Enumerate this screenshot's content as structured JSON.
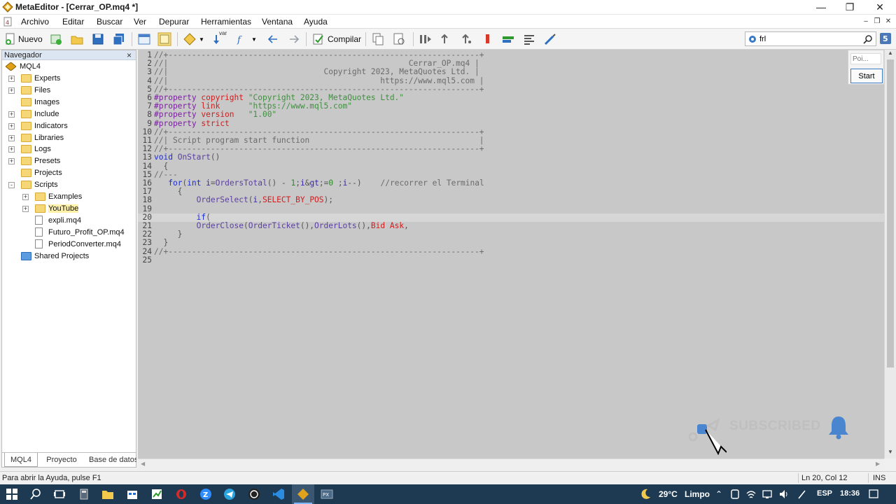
{
  "window": {
    "title": "MetaEditor - [Cerrar_OP.mq4 *]"
  },
  "menu": [
    "Archivo",
    "Editar",
    "Buscar",
    "Ver",
    "Depurar",
    "Herramientas",
    "Ventana",
    "Ayuda"
  ],
  "toolbar": {
    "new_label": "Nuevo",
    "compile_label": "Compilar",
    "var_label": "var",
    "search_value": "frl"
  },
  "navigator": {
    "title": "Navegador",
    "root": "MQL4",
    "items": [
      {
        "label": "Experts",
        "type": "folder",
        "level": 1,
        "expander": "+"
      },
      {
        "label": "Files",
        "type": "folder",
        "level": 1,
        "expander": "+"
      },
      {
        "label": "Images",
        "type": "folder",
        "level": 1,
        "expander": ""
      },
      {
        "label": "Include",
        "type": "folder",
        "level": 1,
        "expander": "+"
      },
      {
        "label": "Indicators",
        "type": "folder",
        "level": 1,
        "expander": "+"
      },
      {
        "label": "Libraries",
        "type": "folder",
        "level": 1,
        "expander": "+"
      },
      {
        "label": "Logs",
        "type": "folder",
        "level": 1,
        "expander": "+"
      },
      {
        "label": "Presets",
        "type": "folder",
        "level": 1,
        "expander": "+"
      },
      {
        "label": "Projects",
        "type": "folder",
        "level": 1,
        "expander": ""
      },
      {
        "label": "Scripts",
        "type": "folder",
        "level": 1,
        "expander": "-"
      },
      {
        "label": "Examples",
        "type": "folder",
        "level": 2,
        "expander": "+"
      },
      {
        "label": "YouTube",
        "type": "folder",
        "level": 2,
        "expander": "+",
        "selected": true
      },
      {
        "label": "expli.mq4",
        "type": "file",
        "level": 2,
        "expander": ""
      },
      {
        "label": "Futuro_Profit_OP.mq4",
        "type": "file",
        "level": 2,
        "expander": ""
      },
      {
        "label": "PeriodConverter.mq4",
        "type": "file",
        "level": 2,
        "expander": ""
      },
      {
        "label": "Shared Projects",
        "type": "shared",
        "level": 1,
        "expander": ""
      }
    ],
    "tabs": [
      "MQL4",
      "Proyecto",
      "Base de datos"
    ]
  },
  "code_lines": [
    {
      "n": "1",
      "t": "//+------------------------------------------------------------------+"
    },
    {
      "n": "2",
      "t": "//|                                                   Cerrar_OP.mq4 |"
    },
    {
      "n": "3",
      "t": "//|                                 Copyright 2023, MetaQuotes Ltd. |"
    },
    {
      "n": "4",
      "t": "//|                                             https://www.mql5.com |"
    },
    {
      "n": "5",
      "t": "//+------------------------------------------------------------------+"
    },
    {
      "n": "6",
      "t": "#property copyright \"Copyright 2023, MetaQuotes Ltd.\""
    },
    {
      "n": "7",
      "t": "#property link      \"https://www.mql5.com\""
    },
    {
      "n": "8",
      "t": "#property version   \"1.00\""
    },
    {
      "n": "9",
      "t": "#property strict"
    },
    {
      "n": "10",
      "t": "//+------------------------------------------------------------------+"
    },
    {
      "n": "11",
      "t": "//| Script program start function                                    |"
    },
    {
      "n": "12",
      "t": "//+------------------------------------------------------------------+"
    },
    {
      "n": "13",
      "t": "void OnStart()"
    },
    {
      "n": "14",
      "t": "  {"
    },
    {
      "n": "15",
      "t": "//---"
    },
    {
      "n": "16",
      "t": "   for(int i=OrdersTotal() - 1;i>=0 ;i--)    //recorrer el Terminal"
    },
    {
      "n": "17",
      "t": "     {"
    },
    {
      "n": "18",
      "t": "         OrderSelect(i,SELECT_BY_POS);"
    },
    {
      "n": "19",
      "t": ""
    },
    {
      "n": "20",
      "t": "         if("
    },
    {
      "n": "21",
      "t": "         OrderClose(OrderTicket(),OrderLots(),Bid Ask,"
    },
    {
      "n": "22",
      "t": "     }"
    },
    {
      "n": "23",
      "t": "  }"
    },
    {
      "n": "24",
      "t": "//+------------------------------------------------------------------+"
    },
    {
      "n": "25",
      "t": ""
    }
  ],
  "float_panel": {
    "placeholder": "Poi...",
    "start_label": "Start"
  },
  "overlay": {
    "subscribed": "SUBSCRIBED"
  },
  "status": {
    "help": "Para abrir la Ayuda, pulse F1",
    "position": "Ln 20, Col 12",
    "mode": "INS"
  },
  "taskbar": {
    "temp": "29°C",
    "weather": "Limpo",
    "lang": "ESP",
    "time": "18:36"
  }
}
